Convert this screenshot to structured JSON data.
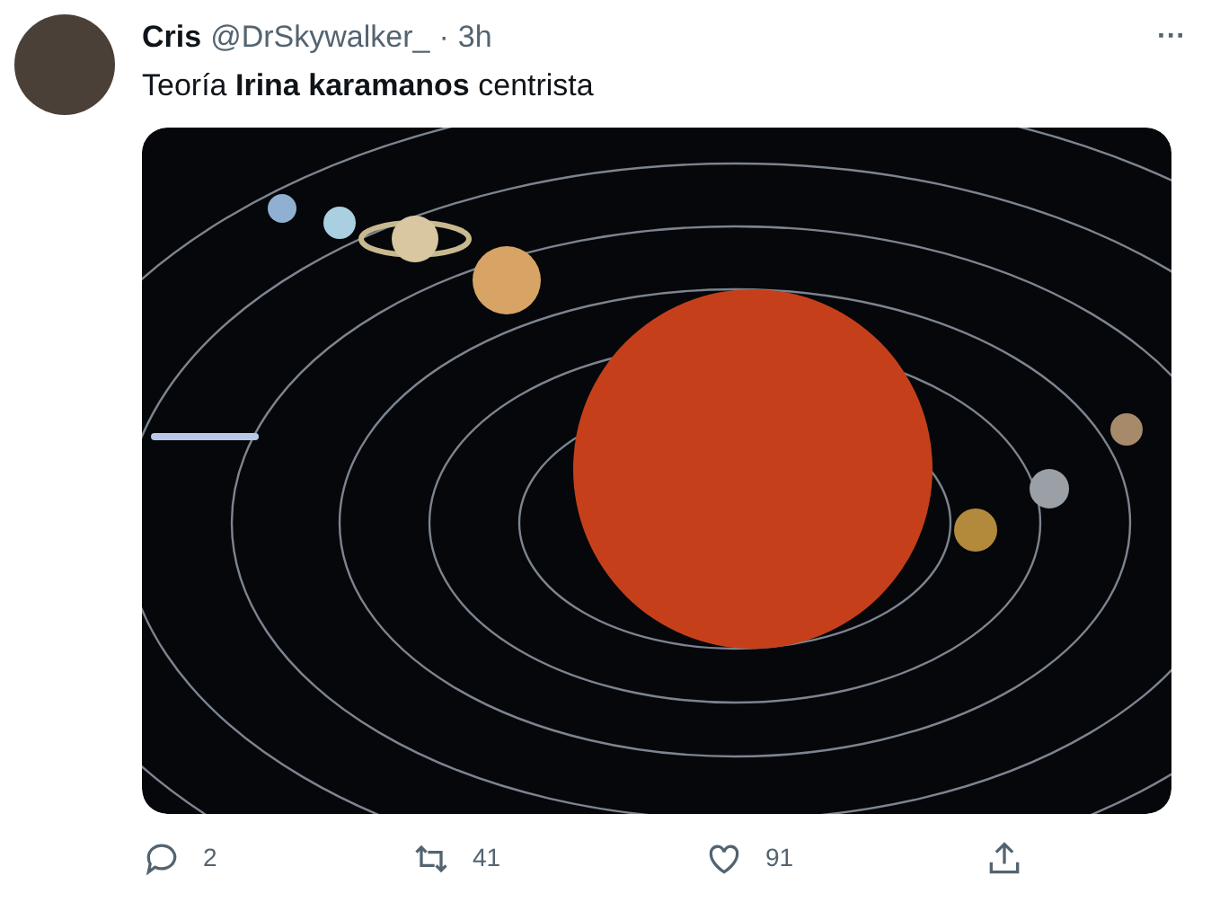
{
  "tweet": {
    "author_name": "Cris",
    "handle": "@DrSkywalker_",
    "separator": "·",
    "time": "3h",
    "more": "···",
    "text": "Teoría **Irina karamanos** centrista"
  },
  "actions": [
    {
      "kind": "reply",
      "count": "2"
    },
    {
      "kind": "retweet",
      "count": "41"
    },
    {
      "kind": "like",
      "count": "91"
    },
    {
      "kind": "share"
    }
  ]
}
